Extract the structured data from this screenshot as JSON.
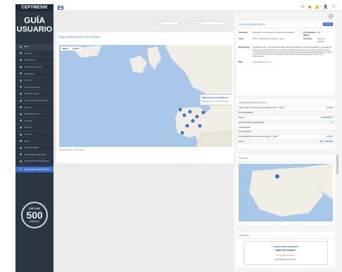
{
  "brand": "CEPYME500",
  "logo": {
    "line1": "GUÍA",
    "line2": "USUARIO"
  },
  "nav": [
    {
      "label": "Inicio",
      "active": true
    },
    {
      "label": "Mi Perfil"
    },
    {
      "label": "Mi Empresa"
    },
    {
      "label": "Mapa de empresas"
    },
    {
      "label": "Mensajería"
    },
    {
      "label": "Ofertas"
    },
    {
      "label": "Notas de prensa"
    },
    {
      "label": "Bolsa de empleo"
    },
    {
      "label": "Programa de colaboración"
    },
    {
      "label": "Eventos"
    },
    {
      "label": "CEPYME500 TV"
    },
    {
      "label": "Actividad"
    },
    {
      "label": "Agenda"
    },
    {
      "label": "Premios"
    },
    {
      "label": "FAQs"
    },
    {
      "label": "CONDICIONES"
    },
    {
      "label": "SERVICIOS PREMIUM"
    },
    {
      "label": "COMPARTIR PROGRAMA"
    },
    {
      "label": "PUBLICIDAD CEPYME500",
      "featured": true
    }
  ],
  "seal": {
    "top": "CEPYME",
    "number": "500",
    "bottom": "EMPRESAS"
  },
  "topbar": {
    "badge": "3"
  },
  "search": {
    "placeholder1": "Buscar",
    "placeholder2": "Buscar por empresas"
  },
  "map_panel": {
    "title": "Mapa EMPRESAS CEPYME500",
    "map_type": [
      "Mapa",
      "Satélite"
    ],
    "footer": "Mostrando: 20 / Total: 500",
    "popup_title": "EMILIAN SAN ANDRÉS SL",
    "popup_addr": "calle del Sureste 7, 33121 Asturias"
  },
  "detail": {
    "title": "EMILIAN SAN ANDRÉS SL",
    "flag": "Favorito",
    "rows": [
      {
        "k": "Actividad",
        "v": "Fabricación de productos de papel de Celulosa",
        "k2": "Nº empleados (2015)",
        "v2": "137"
      },
      {
        "k": "Cnae",
        "v": "1712 - Fabricación de papel y cartón",
        "k2": "Año Reg.",
        "v2": "Asturias - España"
      }
    ],
    "description_label": "Descripción",
    "description": "Fundada en 1917, como negocio familiar, Manlari San Andrés se ha ido desarrollando y expandiendo a través de generaciones hasta convertirse en fabricante de referencia en papel y cartón. Nuestra competencia en producción es un grupo de empresas de varias actividades relacionadas con el papel y cartón. Con la dirección empresarial profesional del Grupo de Empresas de más de 160 profesionales.",
    "web_label": "Web",
    "web": "www.sanandres.com"
  },
  "stats": {
    "title": "Datos económicos del 2015",
    "rows": [
      {
        "label": "Tasa anual crecimiento ventas períodos (2012 - 2015)",
        "value": "34,90%"
      },
      {
        "label": "Nº de Empleados",
        "value": ""
      },
      {
        "label": "Ventas",
        "value": "9.840.983.657"
      },
      {
        "label": "Nº Participaciones Extranjeras",
        "value": "9"
      },
      {
        "label": "Consolidación",
        "value": ""
      },
      {
        "label": "Nº de Patentes",
        "value": ""
      },
      {
        "label": "Rentabilidad económica período (2012 - 2015)",
        "value": "11,89%"
      },
      {
        "label": "Activo",
        "value": "28.177.993.912"
      }
    ]
  },
  "direction": {
    "title": "Dirección"
  },
  "contacts": {
    "title": "Contactos",
    "name": "RAMÓN PEREZ MARTINEZ",
    "role": "DIRECTOR GENERAL",
    "linkedin": "Su perfil de LinkedIn",
    "email": "rperez@sanandres.com"
  }
}
